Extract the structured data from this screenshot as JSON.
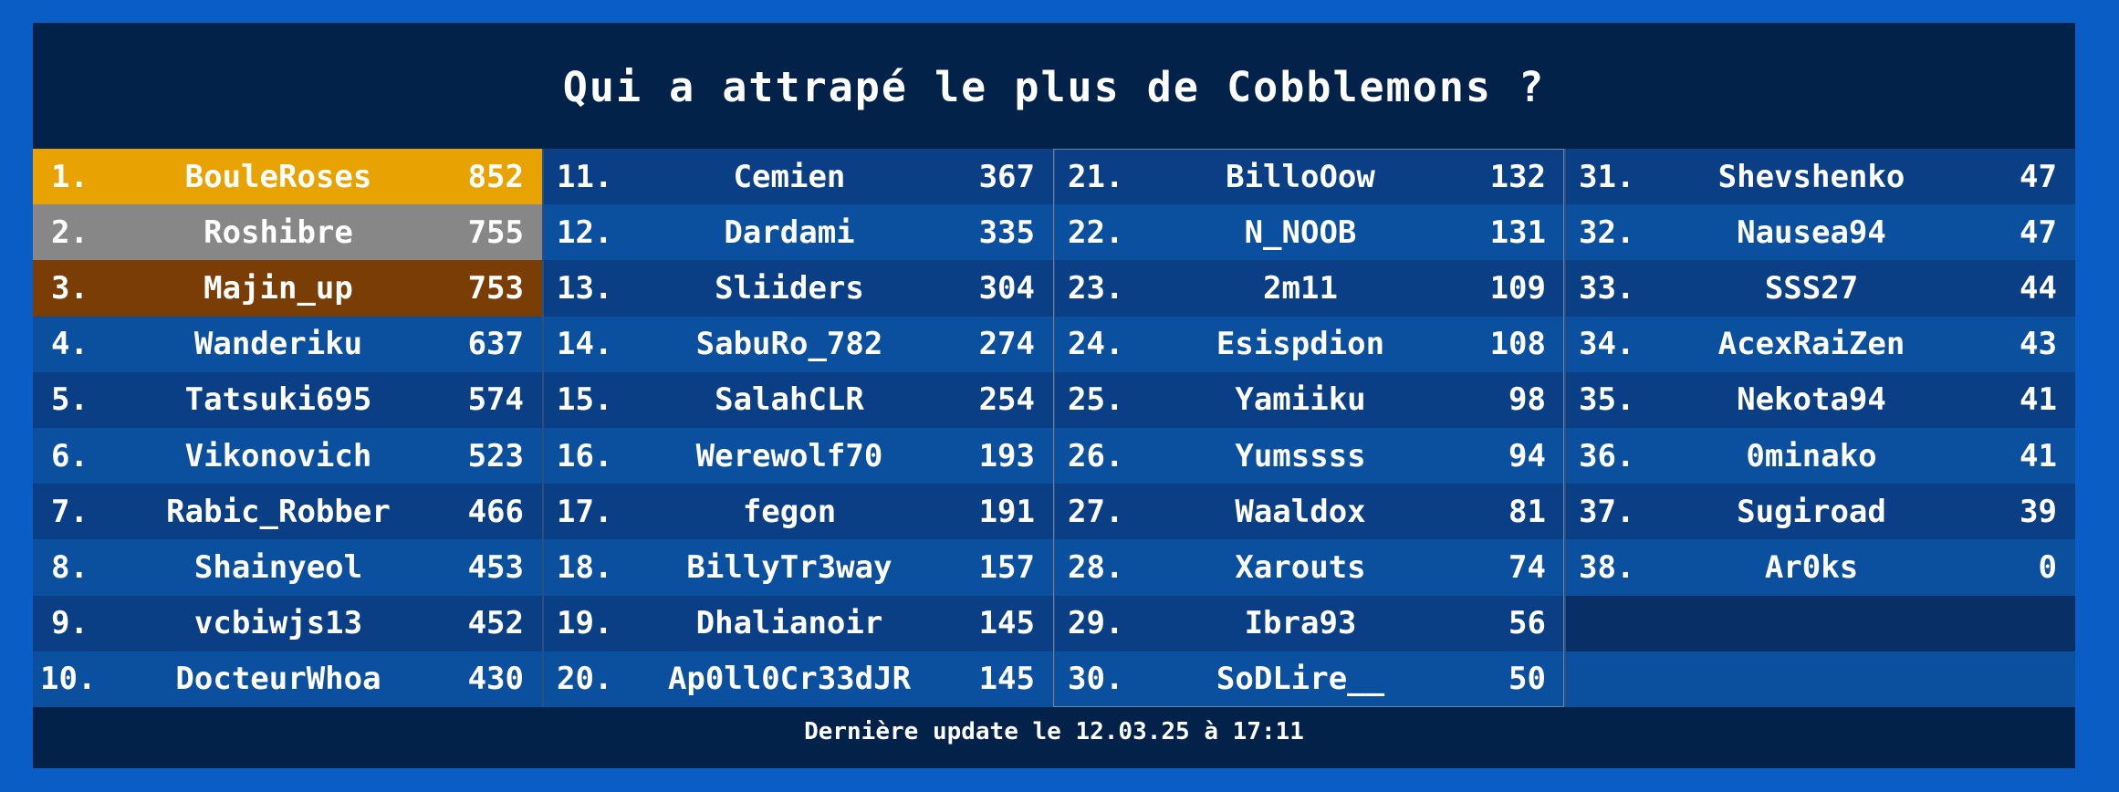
{
  "title": "Qui a attrapé le plus de Cobblemons ?",
  "footer": "Dernière update le 12.03.25 à 17:11",
  "columns": [
    [
      {
        "rank": "1.",
        "name": "BouleRoses",
        "score": "852"
      },
      {
        "rank": "2.",
        "name": "Roshibre",
        "score": "755"
      },
      {
        "rank": "3.",
        "name": "Majin_up",
        "score": "753"
      },
      {
        "rank": "4.",
        "name": "Wanderiku",
        "score": "637"
      },
      {
        "rank": "5.",
        "name": "Tatsuki695",
        "score": "574"
      },
      {
        "rank": "6.",
        "name": "Vikonovich",
        "score": "523"
      },
      {
        "rank": "7.",
        "name": "Rabic_Robber",
        "score": "466"
      },
      {
        "rank": "8.",
        "name": "Shainyeol",
        "score": "453"
      },
      {
        "rank": "9.",
        "name": "vcbiwjs13",
        "score": "452"
      },
      {
        "rank": "10.",
        "name": "DocteurWhoa",
        "score": "430"
      }
    ],
    [
      {
        "rank": "11.",
        "name": "Cemien",
        "score": "367"
      },
      {
        "rank": "12.",
        "name": "Dardami",
        "score": "335"
      },
      {
        "rank": "13.",
        "name": "Sliiders",
        "score": "304"
      },
      {
        "rank": "14.",
        "name": "SabuRo_782",
        "score": "274"
      },
      {
        "rank": "15.",
        "name": "SalahCLR",
        "score": "254"
      },
      {
        "rank": "16.",
        "name": "Werewolf70",
        "score": "193"
      },
      {
        "rank": "17.",
        "name": "fegon",
        "score": "191"
      },
      {
        "rank": "18.",
        "name": "BillyTr3way",
        "score": "157"
      },
      {
        "rank": "19.",
        "name": "Dhalianoir",
        "score": "145"
      },
      {
        "rank": "20.",
        "name": "Ap0ll0Cr33dJR",
        "score": "145"
      }
    ],
    [
      {
        "rank": "21.",
        "name": "BilloOow",
        "score": "132"
      },
      {
        "rank": "22.",
        "name": "N_NOOB",
        "score": "131"
      },
      {
        "rank": "23.",
        "name": "2m11",
        "score": "109"
      },
      {
        "rank": "24.",
        "name": "Esispdion",
        "score": "108"
      },
      {
        "rank": "25.",
        "name": "Yamiiku",
        "score": "98"
      },
      {
        "rank": "26.",
        "name": "Yumssss",
        "score": "94"
      },
      {
        "rank": "27.",
        "name": "Waaldox",
        "score": "81"
      },
      {
        "rank": "28.",
        "name": "Xarouts",
        "score": "74"
      },
      {
        "rank": "29.",
        "name": "Ibra93",
        "score": "56"
      },
      {
        "rank": "30.",
        "name": "SoDLire__",
        "score": "50"
      }
    ],
    [
      {
        "rank": "31.",
        "name": "Shevshenko",
        "score": "47"
      },
      {
        "rank": "32.",
        "name": "Nausea94",
        "score": "47"
      },
      {
        "rank": "33.",
        "name": "SSS27",
        "score": "44"
      },
      {
        "rank": "34.",
        "name": "AcexRaiZen",
        "score": "43"
      },
      {
        "rank": "35.",
        "name": "Nekota94",
        "score": "41"
      },
      {
        "rank": "36.",
        "name": "0minako",
        "score": "41"
      },
      {
        "rank": "37.",
        "name": "Sugiroad",
        "score": "39"
      },
      {
        "rank": "38.",
        "name": "Ar0ks",
        "score": "0"
      }
    ]
  ],
  "colors": {
    "background": "#0a5dc4",
    "panel": "#03224a",
    "row_odd": "#0a3f86",
    "row_even": "#0b4f9f",
    "gold": "#e8a302",
    "silver": "#878787",
    "bronze": "#7a3d05"
  }
}
